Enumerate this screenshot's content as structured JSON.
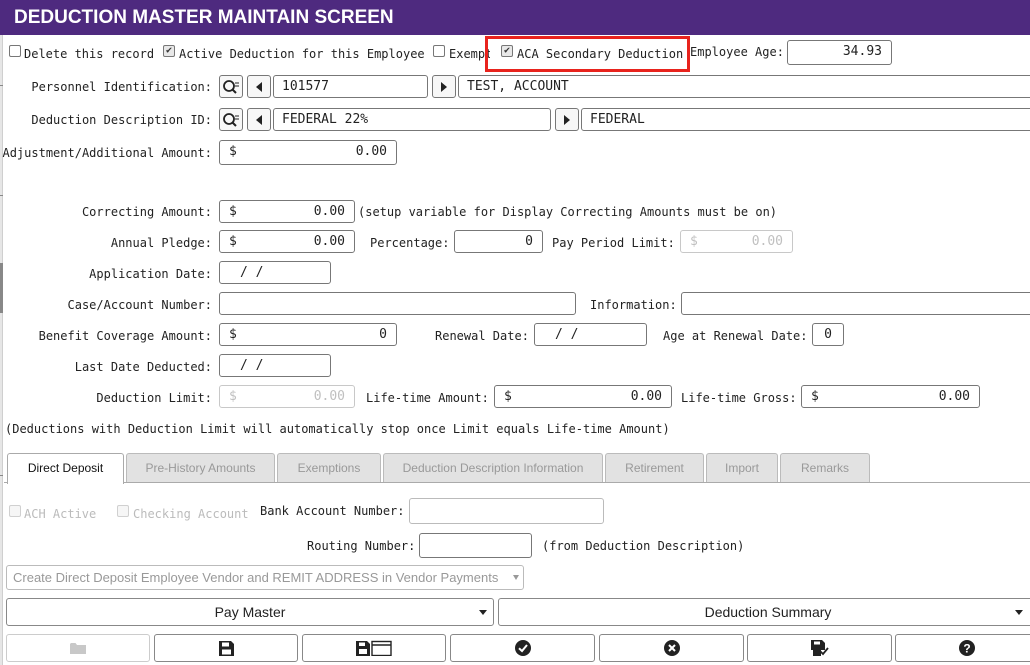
{
  "title": "DEDUCTION MASTER MAINTAIN SCREEN",
  "flags": {
    "delete_record": {
      "label": "Delete this record",
      "checked": false
    },
    "active_deduction": {
      "label": "Active Deduction for this Employee",
      "checked": true
    },
    "exempt": {
      "label": "Exempt",
      "checked": false
    },
    "aca_secondary": {
      "label": "ACA Secondary Deduction",
      "checked": true
    }
  },
  "employee_age": {
    "label": "Employee Age:",
    "value": "34.93"
  },
  "personnel": {
    "label": "Personnel Identification:",
    "id": "101577",
    "name": "TEST, ACCOUNT"
  },
  "deduction_description": {
    "label": "Deduction Description ID:",
    "id": "FEDERAL 22%",
    "name": "FEDERAL"
  },
  "adjustment": {
    "label": "Adjustment/Additional Amount:",
    "currency": "$",
    "value": "0.00"
  },
  "correcting": {
    "label": "Correcting Amount:",
    "currency": "$",
    "value": "0.00",
    "note": "(setup variable for Display Correcting Amounts must be on)"
  },
  "annual_pledge": {
    "label": "Annual Pledge:",
    "currency": "$",
    "value": "0.00"
  },
  "percentage": {
    "label": "Percentage:",
    "value": "0"
  },
  "pay_period_limit": {
    "label": "Pay Period Limit:",
    "currency": "$",
    "value": "0.00"
  },
  "application_date": {
    "label": "Application Date:",
    "value": "/ /"
  },
  "case_account": {
    "label": "Case/Account Number:",
    "value": ""
  },
  "information": {
    "label": "Information:",
    "value": ""
  },
  "benefit_coverage": {
    "label": "Benefit Coverage Amount:",
    "currency": "$",
    "value": "0"
  },
  "renewal_date": {
    "label": "Renewal Date:",
    "value": "/ /"
  },
  "age_at_renewal": {
    "label": "Age at Renewal Date:",
    "value": "0"
  },
  "last_date_deducted": {
    "label": "Last Date Deducted:",
    "value": "/ /"
  },
  "deduction_limit": {
    "label": "Deduction Limit:",
    "currency": "$",
    "value": "0.00"
  },
  "lifetime_amount": {
    "label": "Life-time Amount:",
    "currency": "$",
    "value": "0.00"
  },
  "lifetime_gross": {
    "label": "Life-time Gross:",
    "currency": "$",
    "value": "0.00"
  },
  "limit_note": "(Deductions with Deduction Limit will automatically stop once Limit equals Life-time Amount)",
  "tabs": [
    {
      "label": "Direct Deposit",
      "active": true
    },
    {
      "label": "Pre-History Amounts"
    },
    {
      "label": "Exemptions"
    },
    {
      "label": "Deduction Description Information"
    },
    {
      "label": "Retirement"
    },
    {
      "label": "Import"
    },
    {
      "label": "Remarks"
    }
  ],
  "direct_deposit": {
    "ach_active": {
      "label": "ACH Active",
      "checked": false
    },
    "checking_account": {
      "label": "Checking Account",
      "checked": false
    },
    "bank_account": {
      "label": "Bank Account Number:",
      "value": ""
    },
    "routing_number": {
      "label": "Routing Number:",
      "value": "",
      "note": "(from Deduction Description)"
    },
    "vendor_select": "Create Direct Deposit Employee Vendor and REMIT ADDRESS in Vendor Payments"
  },
  "menus": {
    "pay_master": "Pay Master",
    "deduction_summary": "Deduction Summary"
  },
  "toolbar_icons": [
    "folder-icon",
    "save-icon",
    "save-and-new-icon",
    "check-icon",
    "cancel-icon",
    "save-checked-icon",
    "help-icon"
  ],
  "colors": {
    "titlebar": "#4e2a7f",
    "highlight": "#e8231d"
  }
}
